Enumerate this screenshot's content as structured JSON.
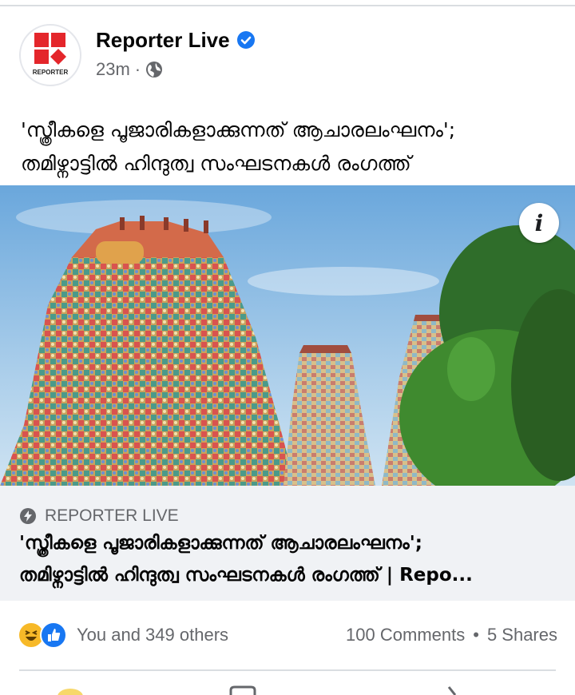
{
  "post": {
    "page_name": "Reporter Live",
    "avatar_logo_text": "REPORTER",
    "time": "23m",
    "meta_separator": "·",
    "audience_icon": "globe-icon",
    "verified_icon": "verified-badge-icon",
    "text_line1": "'സ്ത്രീകളെ പൂജാരികളാക്കുന്നത് ആചാരലംഘനം';",
    "text_line2": "തമിഴ്നാട്ടില്‍ ഹിന്ദുത്വ സംഘടനകള്‍ രംഗത്ത്"
  },
  "media": {
    "info_label": "i",
    "info_icon": "info-icon"
  },
  "link_card": {
    "source_icon": "bolt-icon",
    "source": "REPORTER LIVE",
    "title_line1": "'സ്ത്രീകളെ പൂജാരികളാക്കുന്നത് ആചാരലംഘനം';",
    "title_line2": "തമിഴ്നാട്ടില്‍ ഹിന്ദുത്വ സംഘടനകള്‍ രംഗത്ത് | Repo..."
  },
  "engagement": {
    "reaction_icons": [
      "haha-reaction-icon",
      "like-reaction-icon"
    ],
    "reactions_text": "You and 349 others",
    "comments": "100 Comments",
    "separator": "•",
    "shares": "5 Shares"
  },
  "colors": {
    "brand_red": "#e4262b",
    "facebook_blue": "#1877f2",
    "secondary_text": "#65676b",
    "card_bg": "#f0f2f5"
  }
}
